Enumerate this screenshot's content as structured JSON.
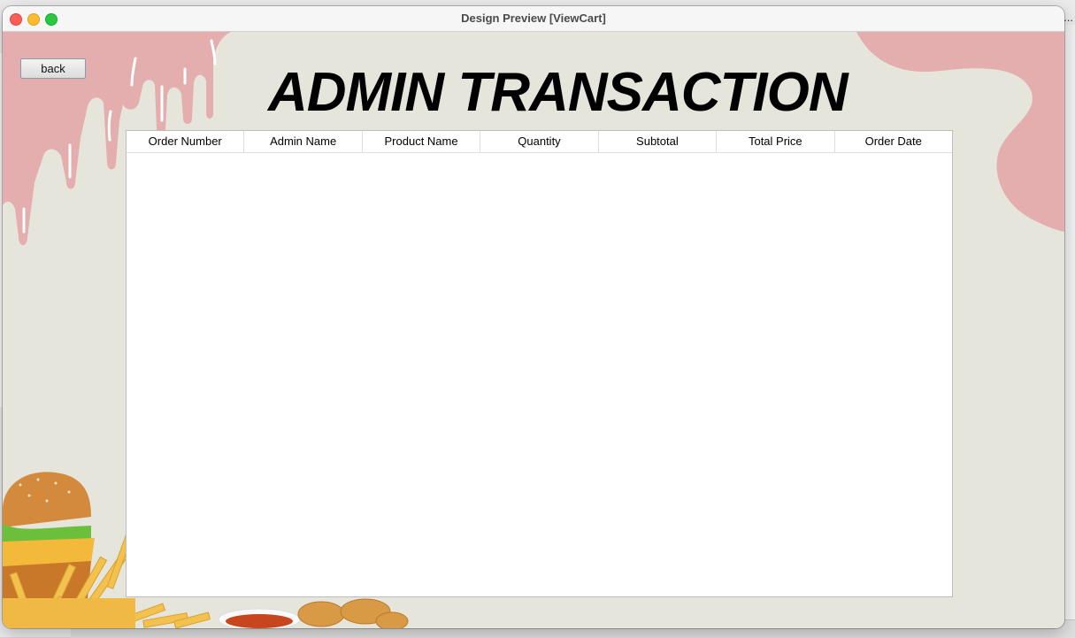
{
  "window": {
    "title": "Design Preview [ViewCart]"
  },
  "back_button": {
    "label": "back"
  },
  "heading": "ADMIN TRANSACTION",
  "table": {
    "columns": [
      "Order Number",
      "Admin Name",
      "Product Name",
      "Quantity",
      "Subtotal",
      "Total Price",
      "Order Date"
    ],
    "rows": []
  },
  "background_overflow_text": "...",
  "colors": {
    "background": "#e6e5dc",
    "drip_pink": "#e4aeae",
    "close": "#ff5f57",
    "minimize": "#febc2e",
    "maximize": "#28c840"
  }
}
